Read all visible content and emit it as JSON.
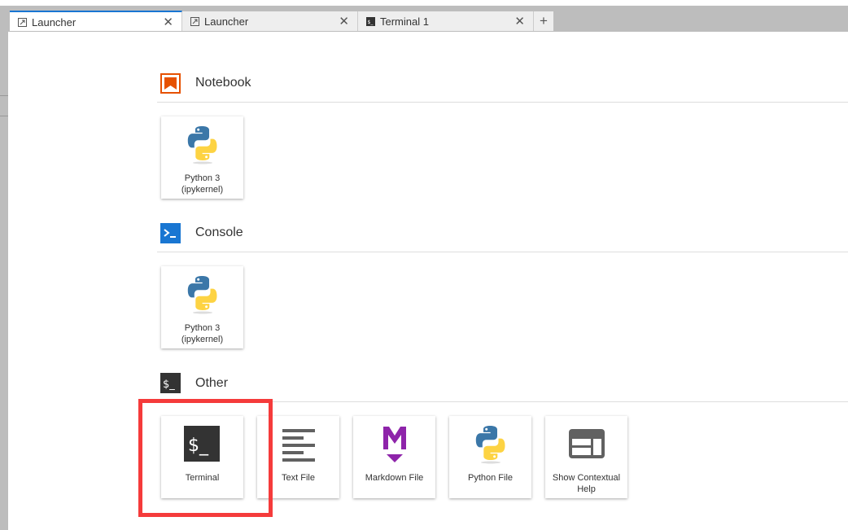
{
  "tabs": [
    {
      "label": "Launcher",
      "icon": "launcher-icon",
      "active": true
    },
    {
      "label": "Launcher",
      "icon": "launcher-icon",
      "active": false
    },
    {
      "label": "Terminal 1",
      "icon": "terminal-icon",
      "active": false
    }
  ],
  "new_tab_label": "+",
  "close_glyph": "✕",
  "sections": {
    "notebook": {
      "title": "Notebook",
      "color": "#e65100",
      "cards": [
        {
          "line1": "Python 3",
          "line2": "(ipykernel)"
        }
      ]
    },
    "console": {
      "title": "Console",
      "color": "#1976d2",
      "cards": [
        {
          "line1": "Python 3",
          "line2": "(ipykernel)"
        }
      ]
    },
    "other": {
      "title": "Other",
      "cards": [
        {
          "label": "Terminal",
          "icon": "terminal-icon"
        },
        {
          "label": "Text File",
          "icon": "text-file-icon"
        },
        {
          "label": "Markdown File",
          "icon": "markdown-icon"
        },
        {
          "label": "Python File",
          "icon": "python-icon"
        },
        {
          "line1": "Show Contextual",
          "line2": "Help",
          "icon": "contextual-help-icon"
        }
      ]
    }
  },
  "highlight_color": "#f53b3b"
}
